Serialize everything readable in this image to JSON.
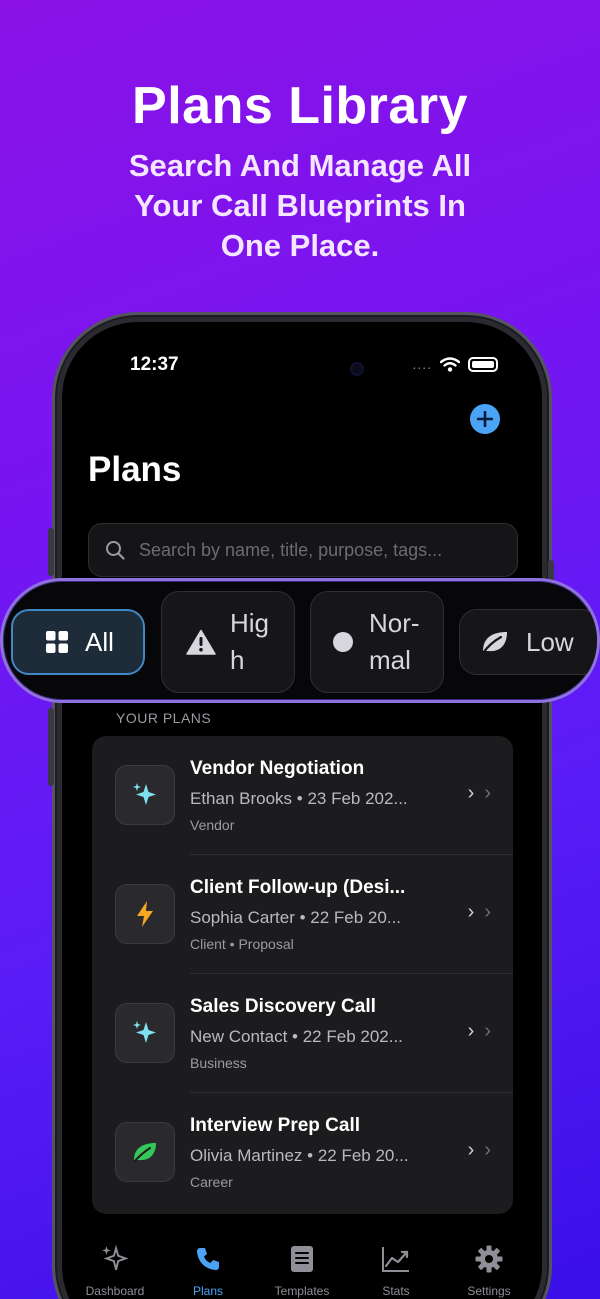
{
  "promo": {
    "title": "Plans Library",
    "subtitle": "Search And Manage All Your Call Blueprints In One Place."
  },
  "status_bar": {
    "time": "12:37",
    "signal": "....",
    "icons": [
      "wifi-icon",
      "battery-icon"
    ]
  },
  "header": {
    "title": "Plans",
    "add_icon": "plus-icon"
  },
  "search": {
    "placeholder": "Search by name, title, purpose, tags..."
  },
  "filters": [
    {
      "label": "All",
      "icon": "grid-icon",
      "selected": true
    },
    {
      "label": "Hig h",
      "icon": "warning-icon",
      "selected": false
    },
    {
      "label": "Nor- mal",
      "icon": "dot-icon",
      "selected": false
    },
    {
      "label": "Low",
      "icon": "leaf-icon",
      "selected": false
    }
  ],
  "section_label": "YOUR PLANS",
  "plans": [
    {
      "title": "Vendor Negotiation",
      "meta": "Ethan Brooks • 23 Feb 202...",
      "tags": "Vendor",
      "icon": "sparkles-icon",
      "icon_color": "#7fe0f0"
    },
    {
      "title": "Client Follow-up (Desi...",
      "meta": "Sophia Carter • 22 Feb 20...",
      "tags": "Client • Proposal",
      "icon": "bolt-icon",
      "icon_color": "#f5a623"
    },
    {
      "title": "Sales Discovery Call",
      "meta": "New Contact • 22 Feb 202...",
      "tags": "Business",
      "icon": "sparkles-icon",
      "icon_color": "#7fe0f0"
    },
    {
      "title": "Interview Prep Call",
      "meta": "Olivia Martinez • 22 Feb 20...",
      "tags": "Career",
      "icon": "leaf-icon",
      "icon_color": "#34c759"
    }
  ],
  "tabs": [
    {
      "label": "Dashboard",
      "icon": "sparkles-icon",
      "active": false
    },
    {
      "label": "Plans",
      "icon": "phone-icon",
      "active": true
    },
    {
      "label": "Templates",
      "icon": "document-icon",
      "active": false
    },
    {
      "label": "Stats",
      "icon": "chart-icon",
      "active": false
    },
    {
      "label": "Settings",
      "icon": "gear-icon",
      "active": false
    }
  ],
  "colors": {
    "accent": "#4aa3f5",
    "background_top": "#8a12e6",
    "background_bottom": "#3a0fe8",
    "filter_outline": "#8f72e0"
  }
}
